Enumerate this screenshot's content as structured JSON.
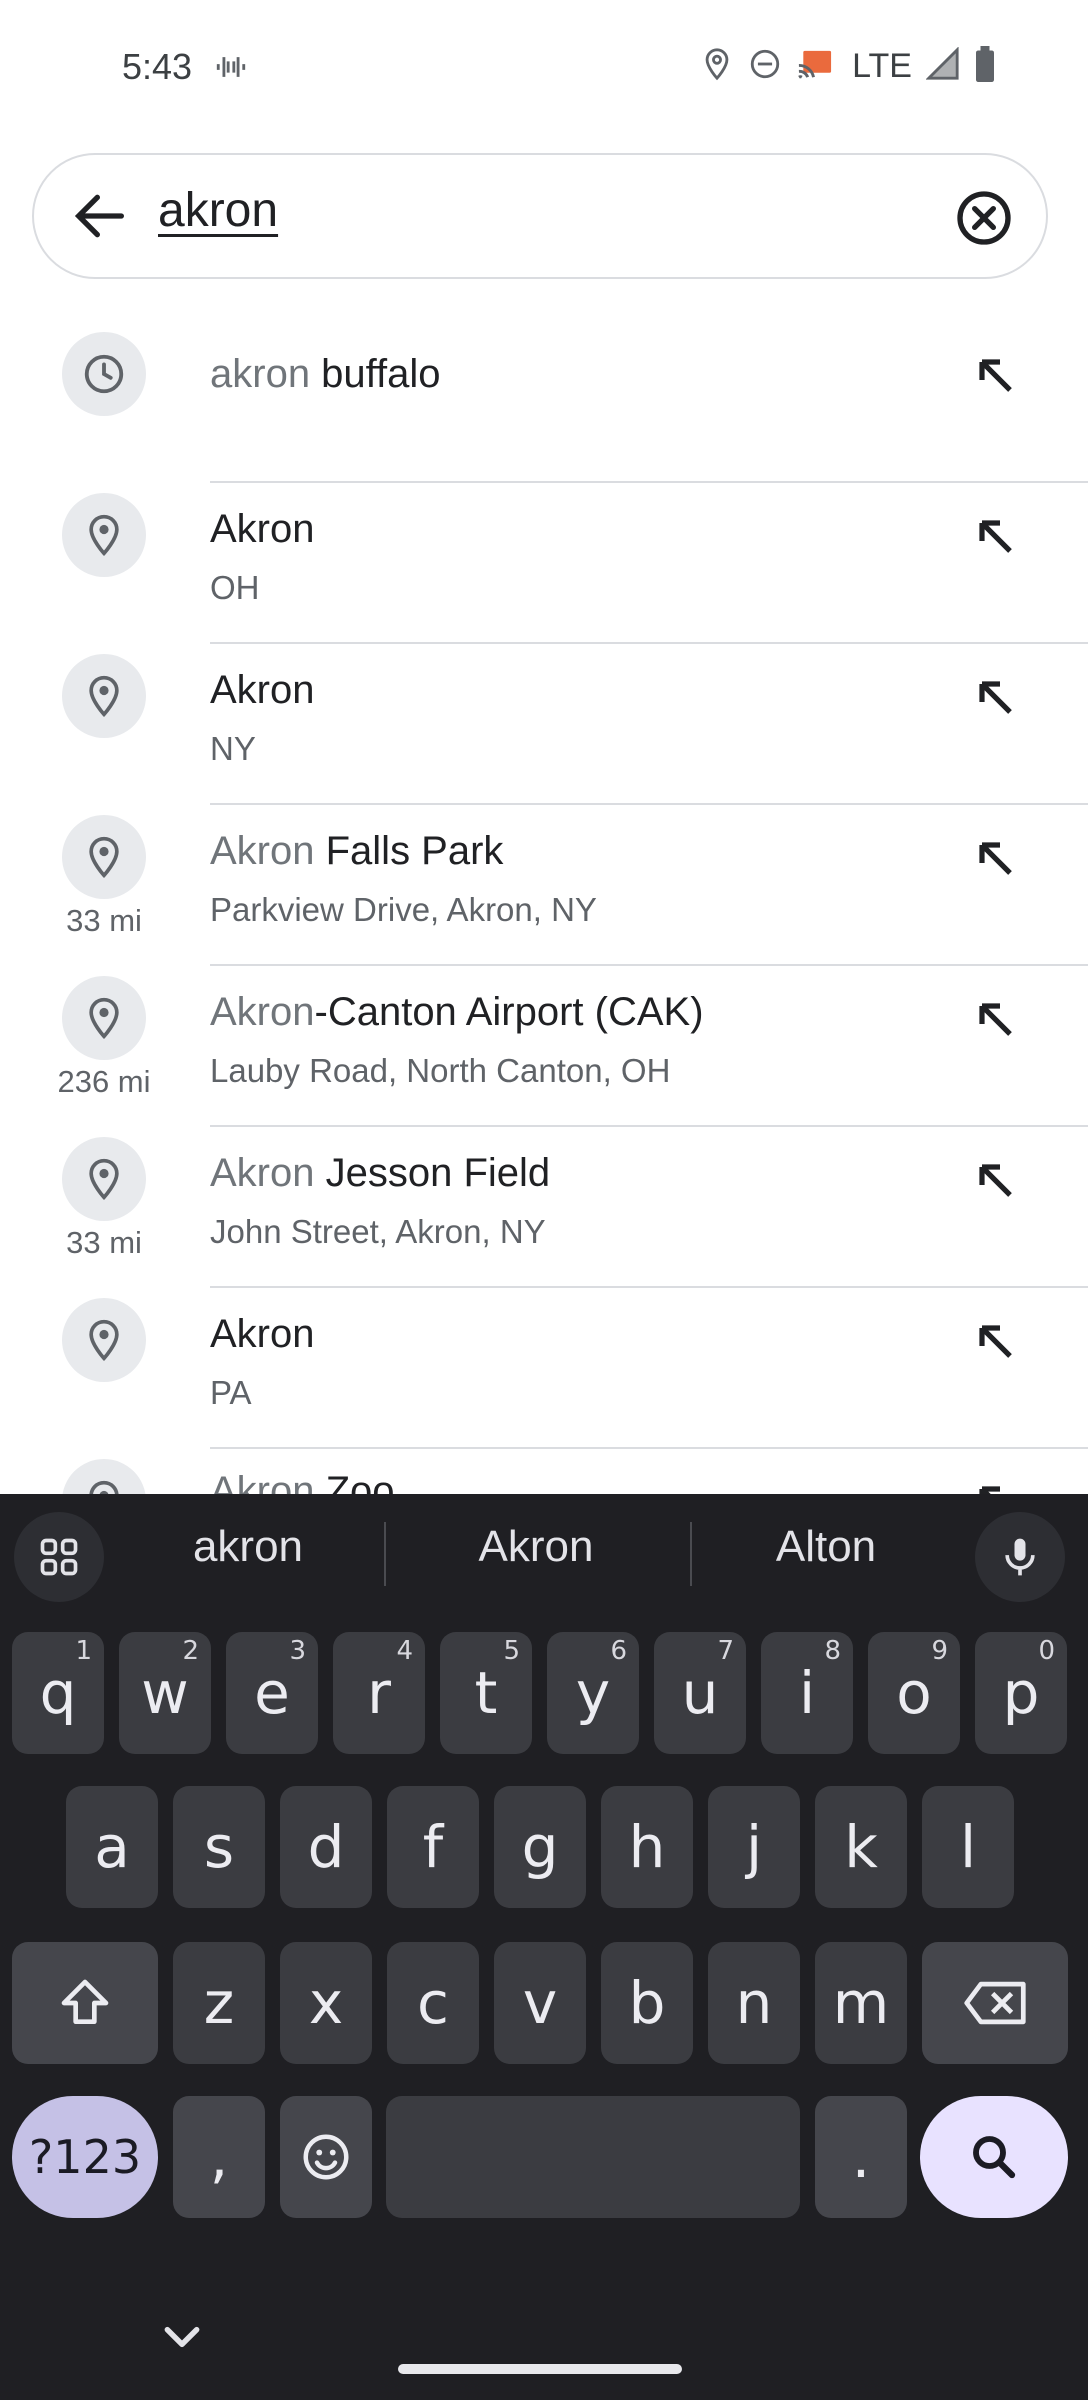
{
  "status_bar": {
    "time": "5:43",
    "network": "LTE",
    "icons": [
      "vibrate-icon",
      "location-icon",
      "do-not-disturb-icon",
      "cast-icon",
      "signal-icon",
      "battery-icon"
    ]
  },
  "search": {
    "query": "akron",
    "back_icon": "arrow-back-icon",
    "clear_icon": "clear-circle-icon"
  },
  "results": [
    {
      "icon": "history-icon",
      "match": "akron",
      "rest": " buffalo",
      "subtitle": "",
      "distance": ""
    },
    {
      "icon": "place-pin-icon",
      "match": "",
      "rest": "Akron",
      "subtitle": "OH",
      "distance": ""
    },
    {
      "icon": "place-pin-icon",
      "match": "",
      "rest": "Akron",
      "subtitle": "NY",
      "distance": ""
    },
    {
      "icon": "place-pin-icon",
      "match": "Akron",
      "rest": " Falls Park",
      "subtitle": "Parkview Drive, Akron, NY",
      "distance": "33 mi"
    },
    {
      "icon": "place-pin-icon",
      "match": "Akron",
      "rest": "-Canton Airport (CAK)",
      "subtitle": "Lauby Road, North Canton, OH",
      "distance": "236 mi"
    },
    {
      "icon": "place-pin-icon",
      "match": "Akron",
      "rest": " Jesson Field",
      "subtitle": "John Street, Akron, NY",
      "distance": "33 mi"
    },
    {
      "icon": "place-pin-icon",
      "match": "",
      "rest": "Akron",
      "subtitle": "PA",
      "distance": ""
    },
    {
      "icon": "place-pin-icon",
      "match": "Akron",
      "rest": " Zoo",
      "subtitle": "",
      "distance": ""
    }
  ],
  "keyboard": {
    "suggestions": [
      "akron",
      "Akron",
      "Alton"
    ],
    "row1": [
      {
        "key": "q",
        "num": "1"
      },
      {
        "key": "w",
        "num": "2"
      },
      {
        "key": "e",
        "num": "3"
      },
      {
        "key": "r",
        "num": "4"
      },
      {
        "key": "t",
        "num": "5"
      },
      {
        "key": "y",
        "num": "6"
      },
      {
        "key": "u",
        "num": "7"
      },
      {
        "key": "i",
        "num": "8"
      },
      {
        "key": "o",
        "num": "9"
      },
      {
        "key": "p",
        "num": "0"
      }
    ],
    "row2": [
      "a",
      "s",
      "d",
      "f",
      "g",
      "h",
      "j",
      "k",
      "l"
    ],
    "row3": [
      "z",
      "x",
      "c",
      "v",
      "b",
      "n",
      "m"
    ],
    "symbols_label": "?123",
    "comma": ",",
    "period": "."
  },
  "colors": {
    "accent_search_key": "#e8e2ff",
    "mode_key": "#c5c1e6",
    "keyboard_bg": "#1f1f23"
  }
}
